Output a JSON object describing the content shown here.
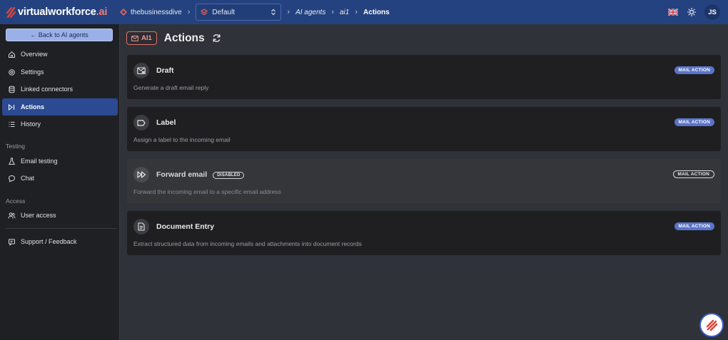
{
  "app": {
    "logo_main": "virtualworkforce",
    "logo_suffix": ".ai"
  },
  "breadcrumb": {
    "org": "thebusinessdive",
    "environment": "Default",
    "section": "AI agents",
    "agent": "ai1",
    "current": "Actions"
  },
  "user": {
    "initials": "JS"
  },
  "sidebar": {
    "back_label": "← Back to AI agents",
    "items": [
      {
        "label": "Overview",
        "icon": "home-icon"
      },
      {
        "label": "Settings",
        "icon": "gear-icon"
      },
      {
        "label": "Linked connectors",
        "icon": "database-icon"
      },
      {
        "label": "Actions",
        "icon": "action-icon",
        "active": true
      },
      {
        "label": "History",
        "icon": "list-icon"
      }
    ],
    "testing_section": "Testing",
    "testing_items": [
      {
        "label": "Email testing",
        "icon": "flask-icon"
      },
      {
        "label": "Chat",
        "icon": "chat-icon"
      }
    ],
    "access_section": "Access",
    "access_items": [
      {
        "label": "User access",
        "icon": "users-icon"
      }
    ],
    "support_label": "Support / Feedback"
  },
  "page": {
    "agent_badge": "AI1",
    "title": "Actions"
  },
  "actions": [
    {
      "title": "Draft",
      "description": "Generate a draft email reply",
      "tag": "MAIL ACTION",
      "icon": "draft-mail-icon",
      "disabled": false
    },
    {
      "title": "Label",
      "description": "Assign a label to the incoming email",
      "tag": "MAIL ACTION",
      "icon": "label-icon",
      "disabled": false
    },
    {
      "title": "Forward email",
      "description": "Forward the incoming email to a specific email address",
      "tag": "MAIL ACTION",
      "icon": "forward-icon",
      "disabled": true,
      "disabled_label": "DISABLED"
    },
    {
      "title": "Document Entry",
      "description": "Extract structured data from incoming emails and attachments into document records",
      "tag": "MAIL ACTION",
      "icon": "document-icon",
      "disabled": false
    }
  ],
  "colors": {
    "topbar": "#24427f",
    "accent": "#5a74c9",
    "brand_red": "#e0443a"
  }
}
